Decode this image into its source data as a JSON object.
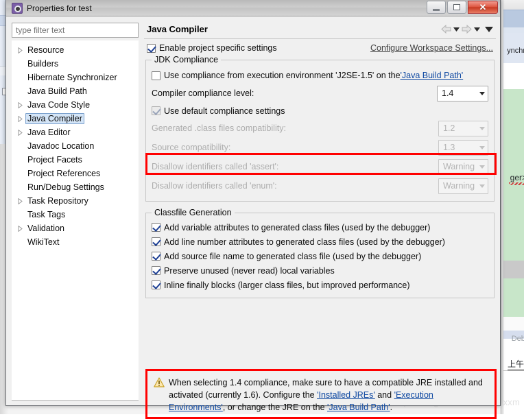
{
  "window": {
    "title": "Properties for test",
    "icon": "gear-icon",
    "minimize_label": "Minimize",
    "maximize_label": "Maximize",
    "close_label": "Close",
    "close_glyph": "✕"
  },
  "sidebar": {
    "filter": {
      "placeholder": "type filter text",
      "value": ""
    },
    "items": [
      {
        "label": "Resource",
        "expandable": true,
        "selected": false
      },
      {
        "label": "Builders",
        "expandable": false,
        "selected": false
      },
      {
        "label": "Hibernate Synchronizer",
        "expandable": false,
        "selected": false
      },
      {
        "label": "Java Build Path",
        "expandable": false,
        "selected": false
      },
      {
        "label": "Java Code Style",
        "expandable": true,
        "selected": false
      },
      {
        "label": "Java Compiler",
        "expandable": true,
        "selected": true
      },
      {
        "label": "Java Editor",
        "expandable": true,
        "selected": false
      },
      {
        "label": "Javadoc Location",
        "expandable": false,
        "selected": false
      },
      {
        "label": "Project Facets",
        "expandable": false,
        "selected": false
      },
      {
        "label": "Project References",
        "expandable": false,
        "selected": false
      },
      {
        "label": "Run/Debug Settings",
        "expandable": false,
        "selected": false
      },
      {
        "label": "Task Repository",
        "expandable": true,
        "selected": false
      },
      {
        "label": "Task Tags",
        "expandable": false,
        "selected": false
      },
      {
        "label": "Validation",
        "expandable": true,
        "selected": false
      },
      {
        "label": "WikiText",
        "expandable": false,
        "selected": false
      }
    ]
  },
  "page": {
    "title": "Java Compiler",
    "nav": {
      "back_icon": "arrow-left-icon",
      "back_menu_icon": "chevron-down-icon",
      "forward_icon": "arrow-right-icon",
      "forward_menu_icon": "chevron-down-icon",
      "overflow_icon": "chevron-down-icon"
    },
    "enable_project_specific": {
      "label": "Enable project specific settings",
      "checked": true
    },
    "configure_workspace_link": "Configure Workspace Settings...",
    "jdk_compliance": {
      "group_title": "JDK Compliance",
      "use_exec_env": {
        "label_prefix": "Use compliance from execution environment 'J2SE-1.5' on the ",
        "link": "'Java Build Path'",
        "checked": false
      },
      "compliance_level": {
        "label": "Compiler compliance level:",
        "value": "1.4",
        "highlighted": true
      },
      "use_default_compliance": {
        "label": "Use default compliance settings",
        "checked": true,
        "enabled": false
      },
      "disabled_fields": [
        {
          "label": "Generated .class files compatibility:",
          "value": "1.2"
        },
        {
          "label": "Source compatibility:",
          "value": "1.3"
        },
        {
          "label": "Disallow identifiers called 'assert':",
          "value": "Warning"
        },
        {
          "label": "Disallow identifiers called 'enum':",
          "value": "Warning"
        }
      ]
    },
    "classfile_generation": {
      "group_title": "Classfile Generation",
      "options": [
        {
          "label": "Add variable attributes to generated class files (used by the debugger)",
          "checked": true
        },
        {
          "label": "Add line number attributes to generated class files (used by the debugger)",
          "checked": true
        },
        {
          "label": "Add source file name to generated class file (used by the debugger)",
          "checked": true
        },
        {
          "label": "Preserve unused (never read) local variables",
          "checked": true
        },
        {
          "label": "Inline finally blocks (larger class files, but improved performance)",
          "checked": true
        }
      ]
    },
    "warning": {
      "icon": "warning-triangle-icon",
      "part1": "When selecting 1.4 compliance, make sure to have a compatible JRE installed and activated (currently 1.6). Configure the ",
      "link1": "'Installed JREs'",
      "part2": " and ",
      "link2": "'Execution Environments'",
      "part3": ", or change the JRE on the ",
      "link3": "'Java Build Path'",
      "part4": ".",
      "highlighted": true
    }
  },
  "background": {
    "text_sync": "ynchr",
    "text_ger": "ger>",
    "text_debug": "Debu",
    "text_time": "上午"
  },
  "watermark": "https://blog.csdn.net/csdn_xxm",
  "colors": {
    "accent_link": "#0d47a1",
    "highlight_red": "#ff0000",
    "selection_blue": "#d4e5f7",
    "dialog_bg": "#f0f0f0"
  }
}
